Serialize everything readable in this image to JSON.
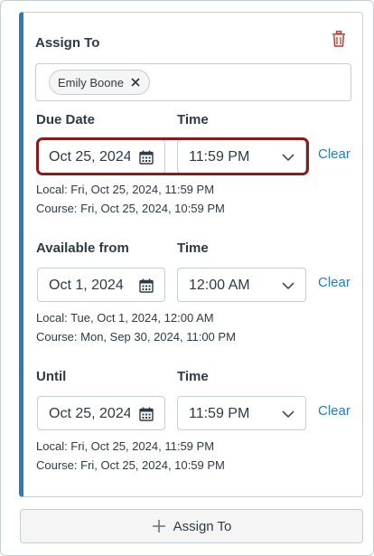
{
  "assign_to": {
    "label": "Assign To",
    "assignees": [
      {
        "name": "Emily Boone"
      }
    ]
  },
  "sections": [
    {
      "date_label": "Due Date",
      "time_label": "Time",
      "date_value": "Oct 25, 2024",
      "time_value": "11:59 PM",
      "clear_label": "Clear",
      "local": "Local: Fri, Oct 25, 2024, 11:59 PM",
      "course": "Course: Fri, Oct 25, 2024, 10:59 PM"
    },
    {
      "date_label": "Available from",
      "time_label": "Time",
      "date_value": "Oct 1, 2024",
      "time_value": "12:00 AM",
      "clear_label": "Clear",
      "local": "Local: Tue, Oct 1, 2024, 12:00 AM",
      "course": "Course: Mon, Sep 30, 2024, 11:00 PM"
    },
    {
      "date_label": "Until",
      "time_label": "Time",
      "date_value": "Oct 25, 2024",
      "time_value": "11:59 PM",
      "clear_label": "Clear",
      "local": "Local: Fri, Oct 25, 2024, 11:59 PM",
      "course": "Course: Fri, Oct 25, 2024, 10:59 PM"
    }
  ],
  "add_assign_button": "Assign To",
  "colors": {
    "accent": "#2b7abc",
    "delete": "#c23c2d",
    "focus": "#8b1a1a",
    "text": "#2d3b45"
  },
  "icons": [
    "trash-icon",
    "remove-icon",
    "calendar-icon",
    "chevron-down-icon",
    "plus-icon"
  ]
}
